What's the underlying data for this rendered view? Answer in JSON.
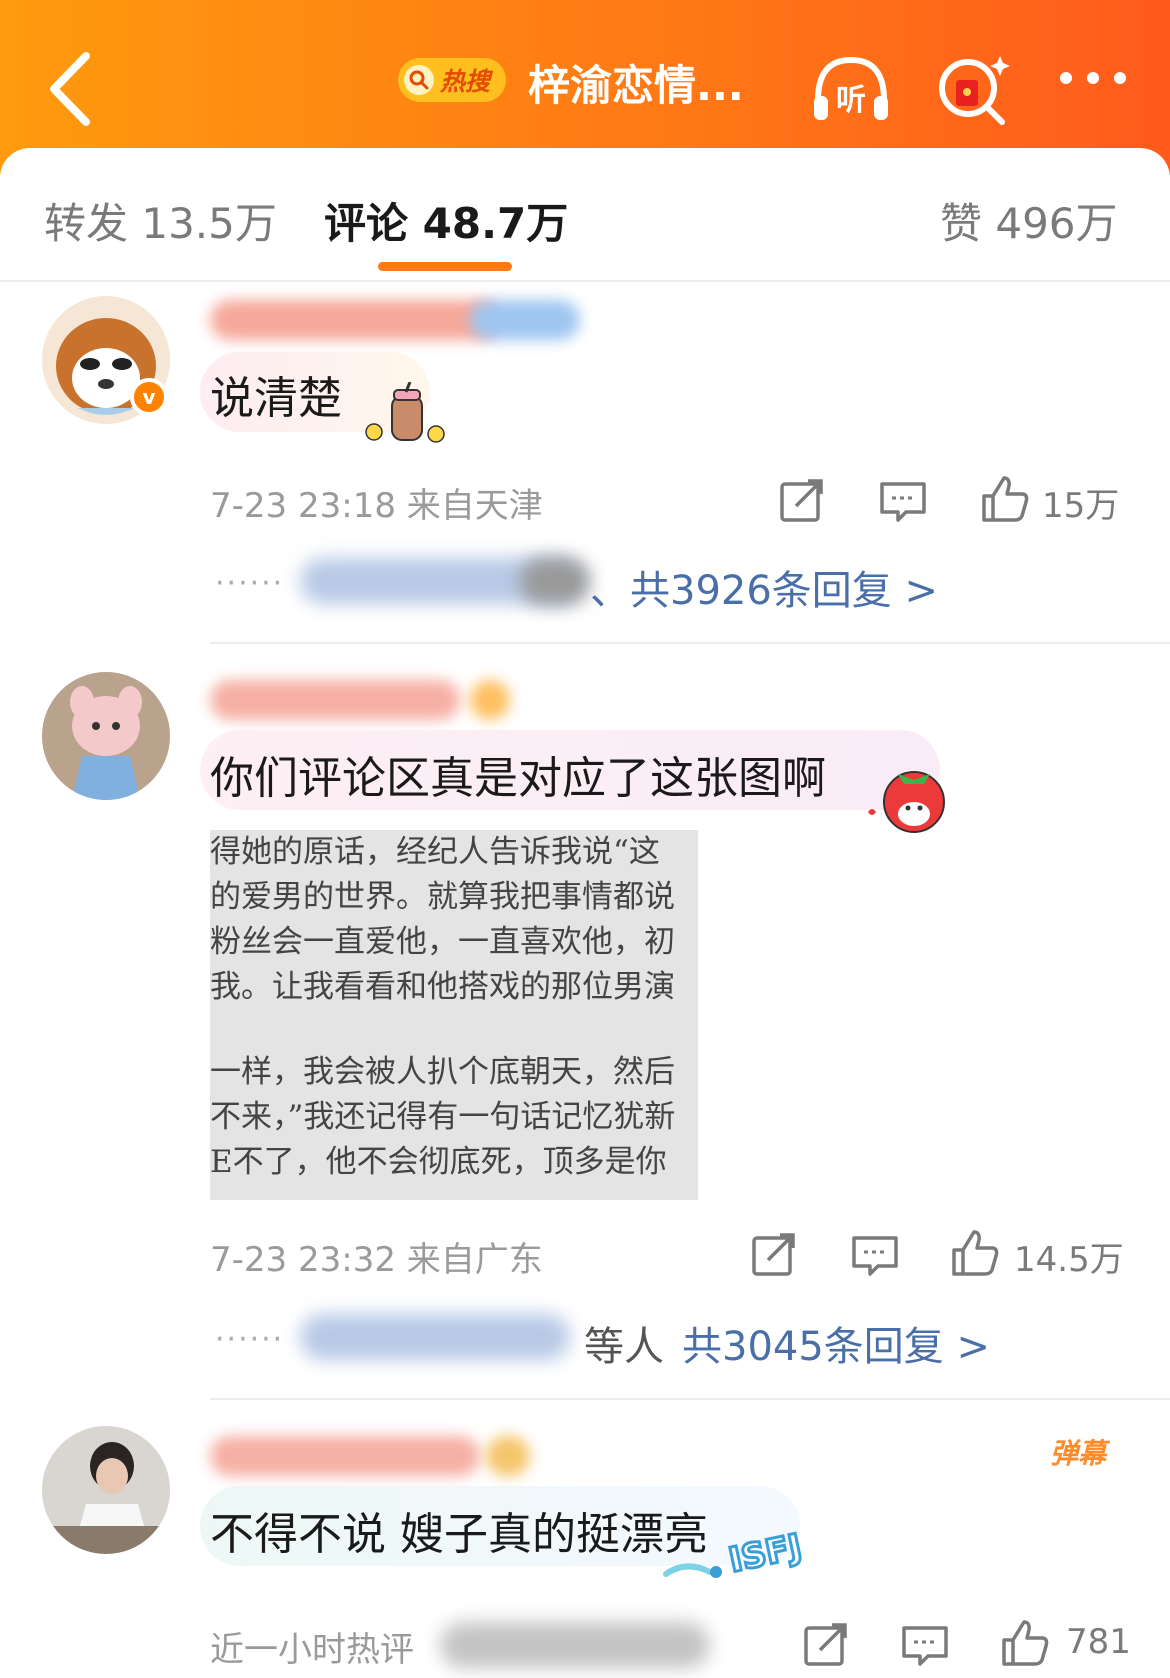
{
  "header": {
    "hot_tag": "热搜",
    "title": "梓渝恋情...",
    "listen_label": "听"
  },
  "tabs": {
    "repost": "转发 13.5万",
    "comments": "评论 48.7万",
    "likes": "赞 496万"
  },
  "comments": [
    {
      "text": "说清楚",
      "time_location": "7-23 23:18 来自天津",
      "like_count": "15万",
      "reply_dots": "······",
      "reply_summary": "、共3926条回复 >"
    },
    {
      "text": "你们评论区真是对应了这张图啊",
      "quote_lines": [
        "得她的原话，经纪人告诉我说“这",
        "的爱男的世界。就算我把事情都说",
        "粉丝会一直爱他，一直喜欢他，初",
        "我。让我看看和他搭戏的那位男演",
        "",
        "一样，我会被人扒个底朝天，然后",
        "不来，”我还记得有一句话记忆犹新",
        "E不了，他不会彻底死，顶多是你"
      ],
      "time_location": "7-23 23:32 来自广东",
      "like_count": "14.5万",
      "reply_dots": "······",
      "reply_prefix": "等人",
      "reply_summary": "共3045条回复 >"
    },
    {
      "text": "不得不说 嫂子真的挺漂亮",
      "danmu": "弹幕",
      "meta": "近一小时热评",
      "like_count": "781",
      "sticker_text": "ISFJ"
    }
  ],
  "colors": {
    "header_gradient_start": "#ff9a0e",
    "header_gradient_end": "#ff5b1c",
    "tab_underline": "#ff7a15",
    "reply_link": "#4a6fa8",
    "verified_badge": "#ff8200"
  }
}
